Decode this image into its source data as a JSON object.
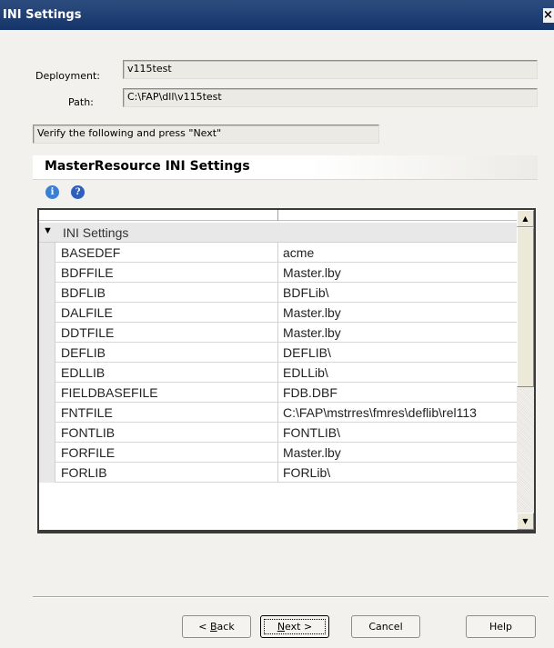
{
  "window": {
    "title": "INI Settings",
    "close_glyph": "×"
  },
  "form": {
    "deployment_label": "Deployment:",
    "deployment_value": "v115test",
    "path_label": "Path:",
    "path_value": "C:\\FAP\\dll\\v115test",
    "instruction": "Verify the following and press \"Next\""
  },
  "section": {
    "title": "MasterResource INI Settings",
    "icons": [
      "info-icon",
      "help-icon"
    ]
  },
  "grid": {
    "group_label": "INI Settings",
    "rows": [
      {
        "key": "BASEDEF",
        "value": "acme"
      },
      {
        "key": "BDFFILE",
        "value": "Master.lby"
      },
      {
        "key": "BDFLIB",
        "value": "BDFLib\\"
      },
      {
        "key": "DALFILE",
        "value": "Master.lby"
      },
      {
        "key": "DDTFILE",
        "value": "Master.lby"
      },
      {
        "key": "DEFLIB",
        "value": "DEFLIB\\"
      },
      {
        "key": "EDLLIB",
        "value": "EDLLib\\"
      },
      {
        "key": "FIELDBASEFILE",
        "value": "FDB.DBF"
      },
      {
        "key": "FNTFILE",
        "value": "C:\\FAP\\mstrres\\fmres\\deflib\\rel113"
      },
      {
        "key": "FONTLIB",
        "value": "FONTLIB\\"
      },
      {
        "key": "FORFILE",
        "value": "Master.lby"
      },
      {
        "key": "FORLIB",
        "value": "FORLib\\"
      }
    ]
  },
  "buttons": {
    "back_prefix": "< ",
    "back_mnemonic": "B",
    "back_rest": "ack",
    "next_mnemonic": "N",
    "next_rest": "ext >",
    "cancel": "Cancel",
    "help": "Help"
  },
  "colors": {
    "titlebar": "#1e3d72",
    "dialog_bg": "#f2f1ee",
    "info_icon": "#3b7fd4",
    "help_icon": "#2f5fb8"
  }
}
